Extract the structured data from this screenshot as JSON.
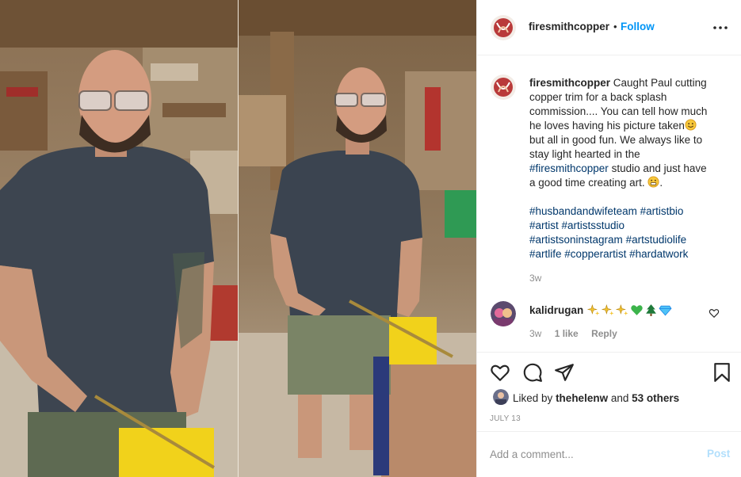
{
  "post": {
    "username": "firesmithcopper",
    "dot": "•",
    "follow_label": "Follow",
    "caption_user": "firesmithcopper",
    "caption_lines": [
      "Caught Paul cutting",
      "copper trim for a back splash",
      "commission.... You can tell how much",
      "he loves having his picture taken",
      "but all in good fun. We always like to",
      "stay light hearted in the",
      "studio and just have",
      "a good time creating art."
    ],
    "caption_mention": "#firesmithcopper",
    "hashtags": [
      "#husbandandwifeteam",
      "#artistbio",
      "#artist",
      "#artistsstudio",
      "#artistsoninstagram",
      "#artstudiolife",
      "#artlife",
      "#copperartist",
      "#hardatwork"
    ],
    "caption_time": "3w"
  },
  "comment": {
    "username": "kalidrugan",
    "emojis": [
      "sparkles-icon",
      "sparkles-icon",
      "sparkles-icon",
      "green-heart-icon",
      "evergreen-tree-icon",
      "gem-icon"
    ],
    "time": "3w",
    "likes": "1 like",
    "reply_label": "Reply"
  },
  "likes": {
    "prefix": "Liked by",
    "user": "thehelenw",
    "and": "and",
    "others": "53 others"
  },
  "date": "JULY 13",
  "add_comment": {
    "placeholder": "Add a comment...",
    "post_label": "Post"
  },
  "colors": {
    "follow": "#0095f6",
    "link": "#00376b",
    "muted": "#8e8e8e",
    "post_disabled": "#b2dffc"
  }
}
